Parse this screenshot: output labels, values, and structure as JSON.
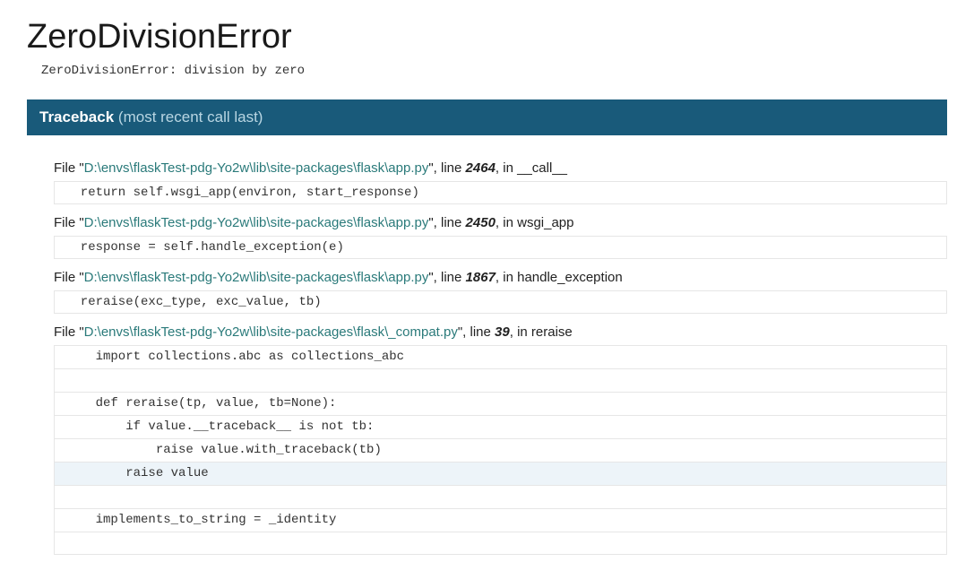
{
  "error": {
    "title": "ZeroDivisionError",
    "summary": "ZeroDivisionError: division by zero"
  },
  "traceback": {
    "label": "Traceback",
    "sub": "(most recent call last)"
  },
  "frames": [
    {
      "path_segments": [
        "D:",
        "\\envs",
        "\\flaskTest-pdg-Yo2w",
        "\\lib",
        "\\site-packages",
        "\\flask",
        "\\app.py"
      ],
      "lineno": "2464",
      "funcname": "__call__",
      "lines": [
        {
          "text": "  return self.wsgi_app(environ, start_response)",
          "hl": false
        }
      ]
    },
    {
      "path_segments": [
        "D:",
        "\\envs",
        "\\flaskTest-pdg-Yo2w",
        "\\lib",
        "\\site-packages",
        "\\flask",
        "\\app.py"
      ],
      "lineno": "2450",
      "funcname": "wsgi_app",
      "lines": [
        {
          "text": "  response = self.handle_exception(e)",
          "hl": false
        }
      ]
    },
    {
      "path_segments": [
        "D:",
        "\\envs",
        "\\flaskTest-pdg-Yo2w",
        "\\lib",
        "\\site-packages",
        "\\flask",
        "\\app.py"
      ],
      "lineno": "1867",
      "funcname": "handle_exception",
      "lines": [
        {
          "text": "  reraise(exc_type, exc_value, tb)",
          "hl": false
        }
      ]
    },
    {
      "path_segments": [
        "D:",
        "\\envs",
        "\\flaskTest-pdg-Yo2w",
        "\\lib",
        "\\site-packages",
        "\\flask",
        "\\_compat.py"
      ],
      "lineno": "39",
      "funcname": "reraise",
      "lines": [
        {
          "text": "    import collections.abc as collections_abc",
          "hl": false
        },
        {
          "text": " ",
          "hl": false
        },
        {
          "text": "    def reraise(tp, value, tb=None):",
          "hl": false
        },
        {
          "text": "        if value.__traceback__ is not tb:",
          "hl": false
        },
        {
          "text": "            raise value.with_traceback(tb)",
          "hl": false
        },
        {
          "text": "        raise value",
          "hl": true
        },
        {
          "text": " ",
          "hl": false
        },
        {
          "text": "    implements_to_string = _identity",
          "hl": false
        },
        {
          "text": " ",
          "hl": false
        }
      ]
    }
  ],
  "labels": {
    "file_prefix": "File \"",
    "file_suffix": "\", line ",
    "in_prefix": ", in "
  }
}
